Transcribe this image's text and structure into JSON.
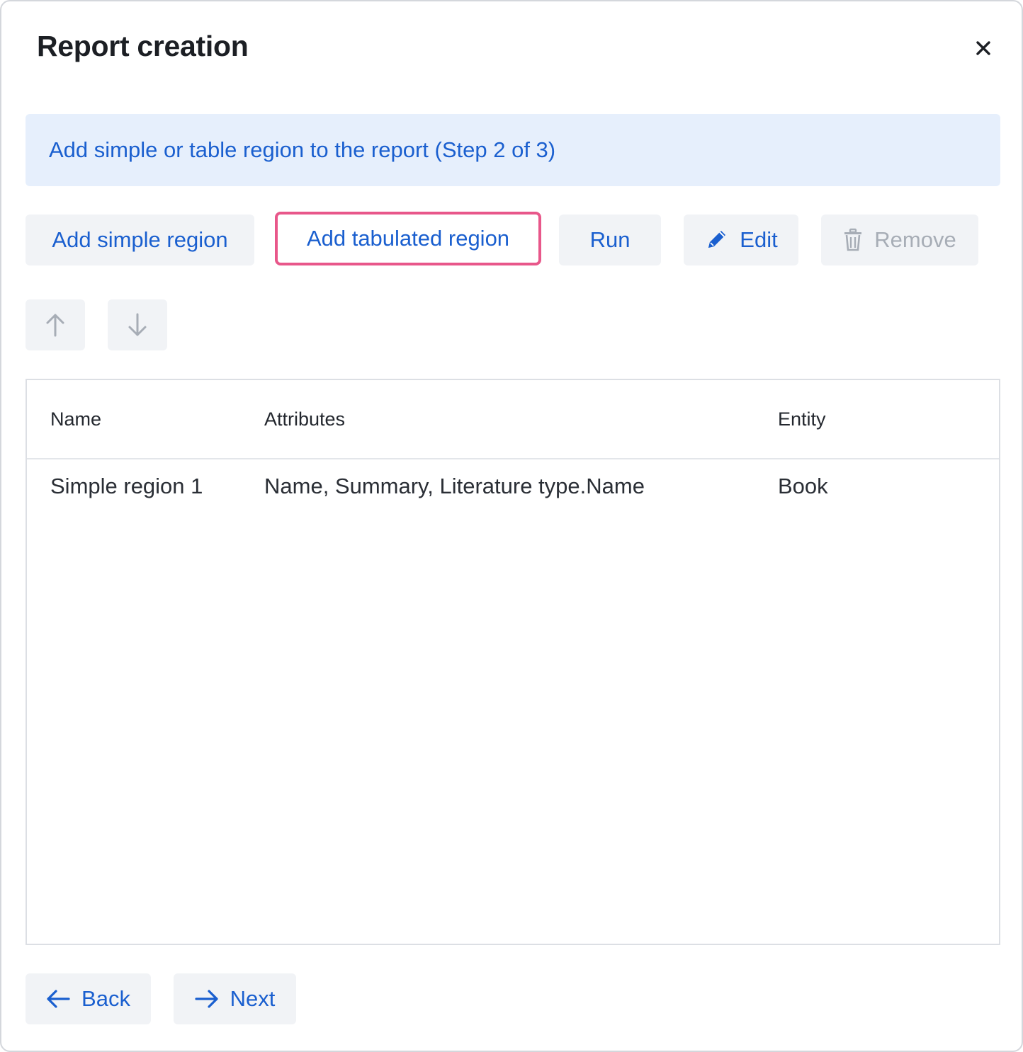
{
  "dialog": {
    "title": "Report creation",
    "close_symbol": "×"
  },
  "banner": {
    "text": "Add simple or table region to the report (Step 2 of 3)"
  },
  "toolbar": {
    "add_simple_label": "Add simple region",
    "add_tabulated_label": "Add tabulated region",
    "run_label": "Run",
    "edit_label": "Edit",
    "remove_label": "Remove",
    "edit_icon": "pencil-icon",
    "remove_icon": "trash-icon"
  },
  "order_controls": {
    "up_icon": "arrow-up-icon",
    "down_icon": "arrow-down-icon"
  },
  "table": {
    "columns": [
      "Name",
      "Attributes",
      "Entity"
    ],
    "rows": [
      [
        "Simple region 1",
        "Name, Summary, Literature type.Name",
        "Book"
      ]
    ]
  },
  "footer": {
    "back_label": "Back",
    "next_label": "Next"
  },
  "colors": {
    "accent": "#1a5fcf",
    "banner_bg": "#e6effc",
    "focus_ring": "#e8578a",
    "disabled": "#a7adb6"
  }
}
